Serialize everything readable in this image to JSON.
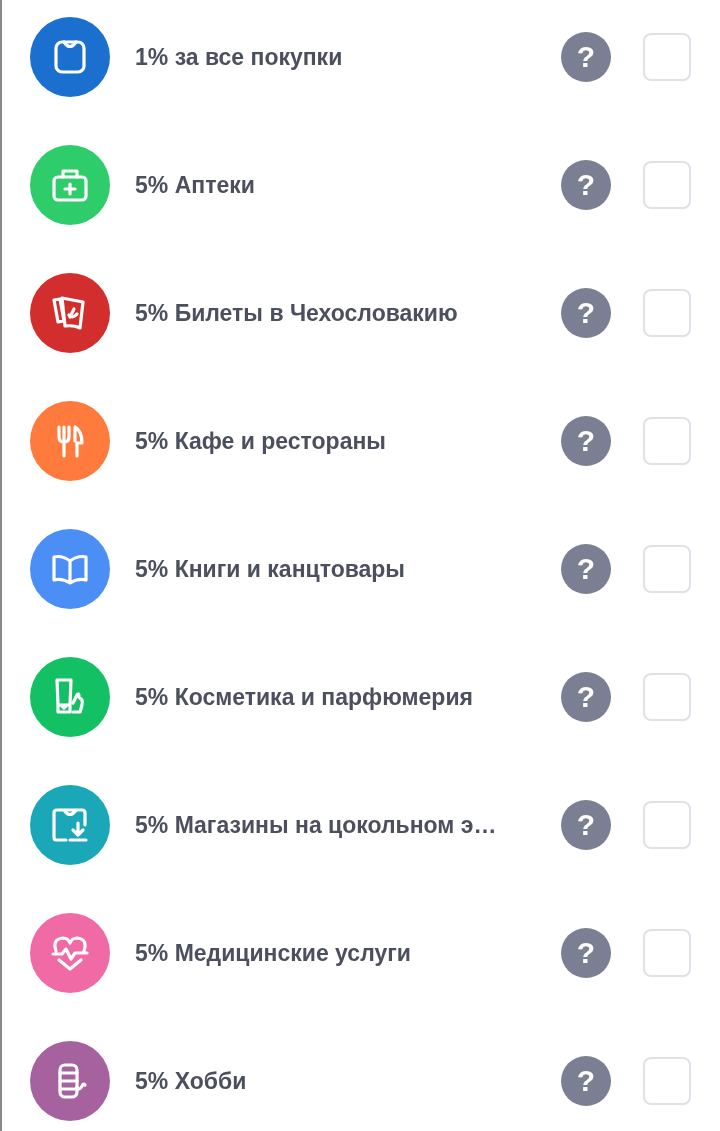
{
  "categories": [
    {
      "label": "1% за все покупки",
      "color": "#1b6fcf",
      "checked": false
    },
    {
      "label": "5% Аптеки",
      "color": "#2ecc6b",
      "checked": false
    },
    {
      "label": "5% Билеты в Чехословакию",
      "color": "#d22e2e",
      "checked": false
    },
    {
      "label": "5% Кафе и рестораны",
      "color": "#ff7a3d",
      "checked": false
    },
    {
      "label": "5% Книги и канцтовары",
      "color": "#4b8ef5",
      "checked": false
    },
    {
      "label": "5% Косметика и парфюмерия",
      "color": "#14c064",
      "checked": false
    },
    {
      "label": "5% Магазины на цокольном э…",
      "color": "#1aa7b8",
      "checked": false
    },
    {
      "label": "5% Медицинские услуги",
      "color": "#f06aa6",
      "checked": false
    },
    {
      "label": "5% Хобби",
      "color": "#a5629f",
      "checked": false
    }
  ],
  "help_mark": "?"
}
